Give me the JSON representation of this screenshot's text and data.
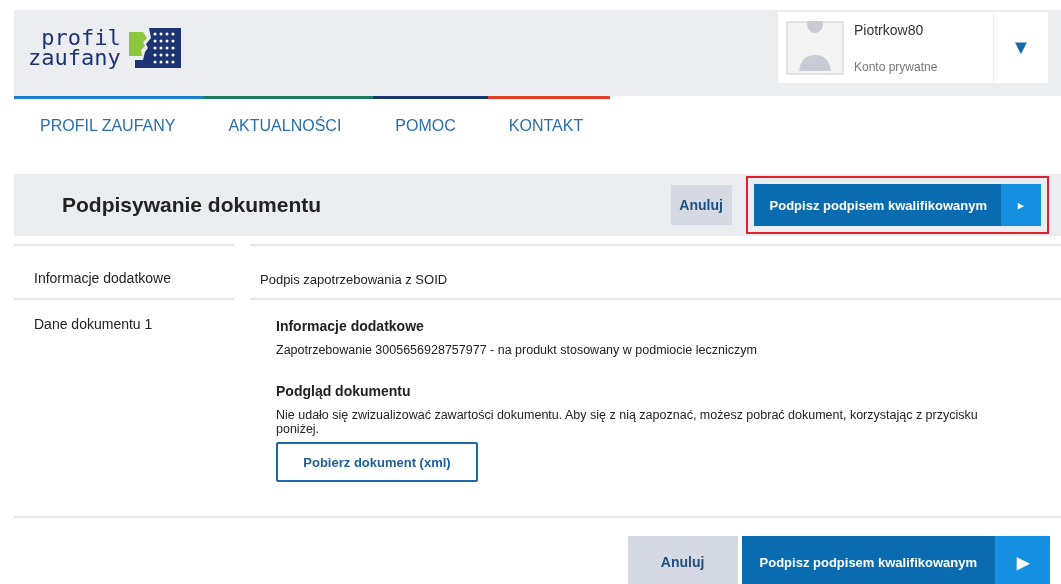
{
  "logo": {
    "line_1": "profil",
    "line_2": "zaufany"
  },
  "user": {
    "name": "Piotrkow80",
    "account": "Konto prywatne",
    "menu_icon": "▼"
  },
  "nav": [
    {
      "label": "PROFIL ZAUFANY",
      "color": "#1a7fc8"
    },
    {
      "label": "AKTUALNOŚCI",
      "color": "#1d7a5a"
    },
    {
      "label": "POMOC",
      "color": "#1d3473"
    },
    {
      "label": "KONTAKT",
      "color": "#e0402a"
    }
  ],
  "header": {
    "title": "Podpisywanie dokumentu",
    "cancel": "Anuluj",
    "sign": {
      "label": "Podpisz podpisem kwalifikowanym",
      "arrow": "▸",
      "highlighted": true
    }
  },
  "rows": [
    {
      "label": "Informacje dodatkowe",
      "value": "Podpis zapotrzebowania z SOID"
    }
  ],
  "document": {
    "label": "Dane dokumentu 1",
    "info_title": "Informacje dodatkowe",
    "info_text": "Zapotrzebowanie 3005656928757977 - na produkt stosowany w podmiocie leczniczym",
    "preview_title": "Podgląd dokumentu",
    "preview_text": "Nie udało się zwizualizować zawartości dokumentu. Aby się z nią zapoznać, możesz pobrać dokument, korzystając z przycisku poniżej.",
    "download": "Pobierz dokument (xml)"
  },
  "footer": {
    "cancel": "Anuluj",
    "sign": {
      "label": "Podpisz podpisem kwalifikowanym",
      "arrow": "▶"
    }
  }
}
